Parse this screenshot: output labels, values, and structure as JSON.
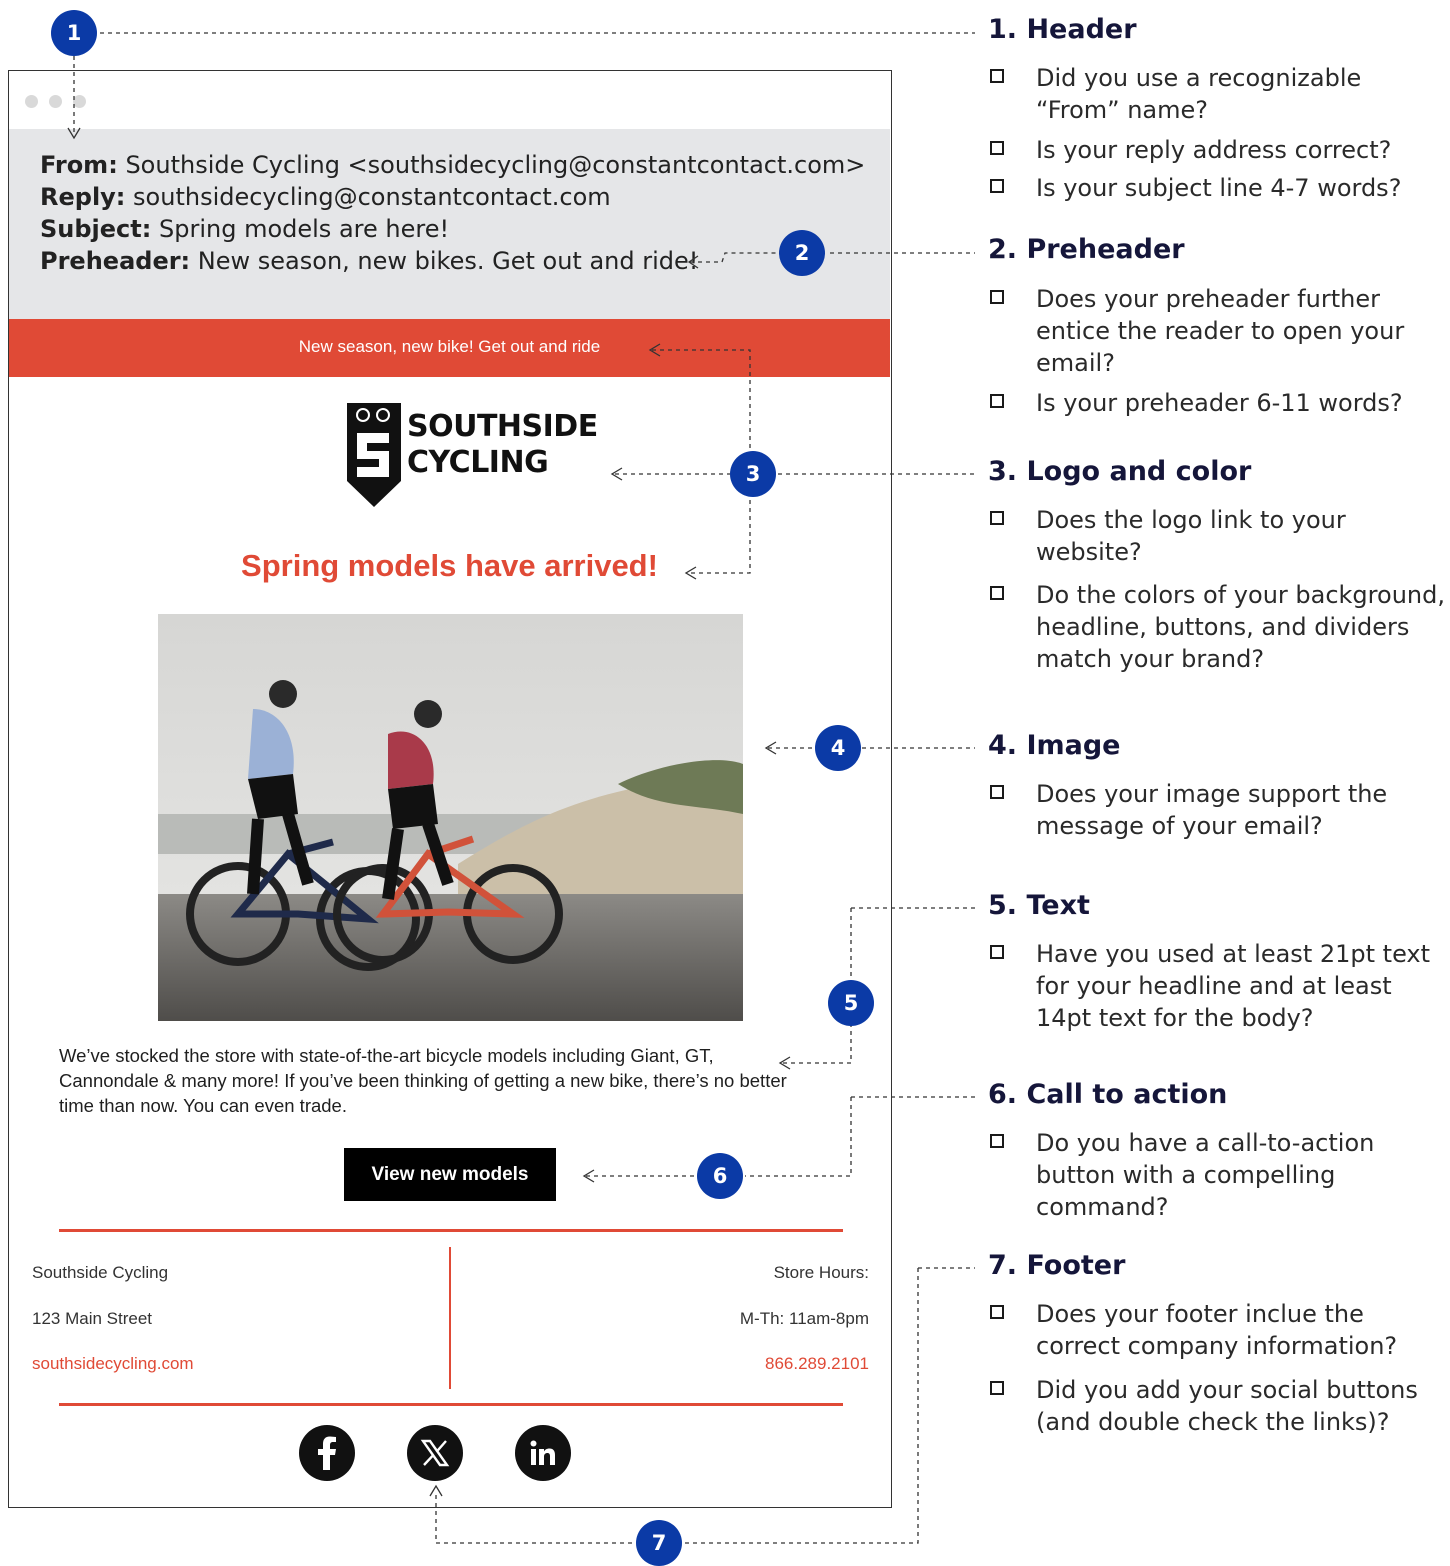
{
  "email": {
    "header": {
      "from_label": "From:",
      "from_value": "Southside Cycling <southsidecycling@constantcontact.com>",
      "reply_label": "Reply:",
      "reply_value": "southsidecycling@constantcontact.com",
      "subject_label": "Subject:",
      "subject_value": "Spring models are here!",
      "preheader_label": "Preheader:",
      "preheader_value": "New season, new bikes. Get out and ride!"
    },
    "preheader_bar_text": "New season, new bike! Get out and ride",
    "logo": {
      "line1": "SOUTHSIDE",
      "line2": "CYCLING"
    },
    "headline": "Spring models have arrived!",
    "photo_alt": "two-cyclists-on-coastal-road-icon",
    "body_line1": "We’ve stocked the store with state-of-the-art bicycle models including Giant, GT,",
    "body_line2": "Cannondale & many more! If you’ve been thinking of getting a new bike, there’s no better",
    "body_line3": "time than now. You can even trade.",
    "cta_label": "View new models",
    "footer": {
      "company": "Southside Cycling",
      "address": "123 Main Street",
      "website": "southsidecycling.com",
      "hours_label": "Store Hours:",
      "hours": "M-Th: 11am-8pm",
      "phone": "866.289.2101"
    },
    "social_icons": [
      "facebook-icon",
      "x-icon",
      "linkedin-icon"
    ]
  },
  "badges": [
    "1",
    "2",
    "3",
    "4",
    "5",
    "6",
    "7"
  ],
  "checklist": [
    {
      "title": "1. Header",
      "items": [
        "Did you use a recognizable “From” name?",
        "Is your reply address correct?",
        "Is your subject line 4-7 words?"
      ]
    },
    {
      "title": "2. Preheader",
      "items": [
        "Does your preheader further entice the reader to open your email?",
        "Is your preheader 6-11 words?"
      ]
    },
    {
      "title": "3. Logo and color",
      "items": [
        "Does the logo link to your website?",
        "Do the colors of your background, headline, buttons, and dividers match your brand?"
      ]
    },
    {
      "title": "4. Image",
      "items": [
        "Does your image support the message of your email?"
      ]
    },
    {
      "title": "5. Text",
      "items": [
        "Have you used at least 21pt text for your headline and at least 14pt text for the body?"
      ]
    },
    {
      "title": "6. Call to action",
      "items": [
        "Do you have a call-to-action button with a compelling command?"
      ]
    },
    {
      "title": "7. Footer",
      "items": [
        "Does your footer inclue the correct company information?",
        "Did you add your social buttons (and double check the links)?"
      ]
    }
  ],
  "colors": {
    "brand_red": "#e04a36",
    "badge_blue": "#0b3aa6",
    "header_gray": "#e5e6e8"
  }
}
